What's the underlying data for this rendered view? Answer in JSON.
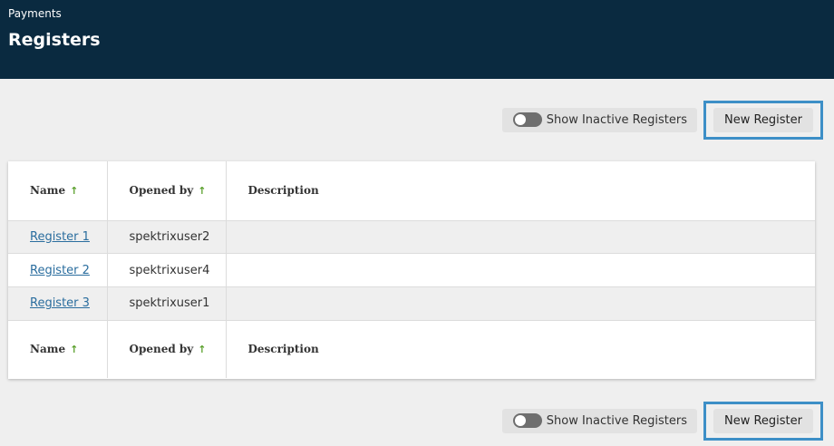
{
  "header": {
    "breadcrumb": "Payments",
    "title": "Registers"
  },
  "toolbar": {
    "toggle_label": "Show Inactive Registers",
    "toggle_on": false,
    "new_button_label": "New Register"
  },
  "table": {
    "columns": [
      "Name",
      "Opened by",
      "Description"
    ],
    "rows": [
      {
        "name": "Register 1",
        "opened_by": "spektrixuser2",
        "description": ""
      },
      {
        "name": "Register 2",
        "opened_by": "spektrixuser4",
        "description": ""
      },
      {
        "name": "Register 3",
        "opened_by": "spektrixuser1",
        "description": ""
      }
    ]
  },
  "colors": {
    "header_bg": "#0a2a40",
    "highlight_border": "#3d8fc7",
    "sort_arrow": "#5aa02c",
    "link": "#2a6d9e"
  },
  "icons": {
    "sort": "arrow-up-icon",
    "toggle": "toggle-switch-icon"
  }
}
